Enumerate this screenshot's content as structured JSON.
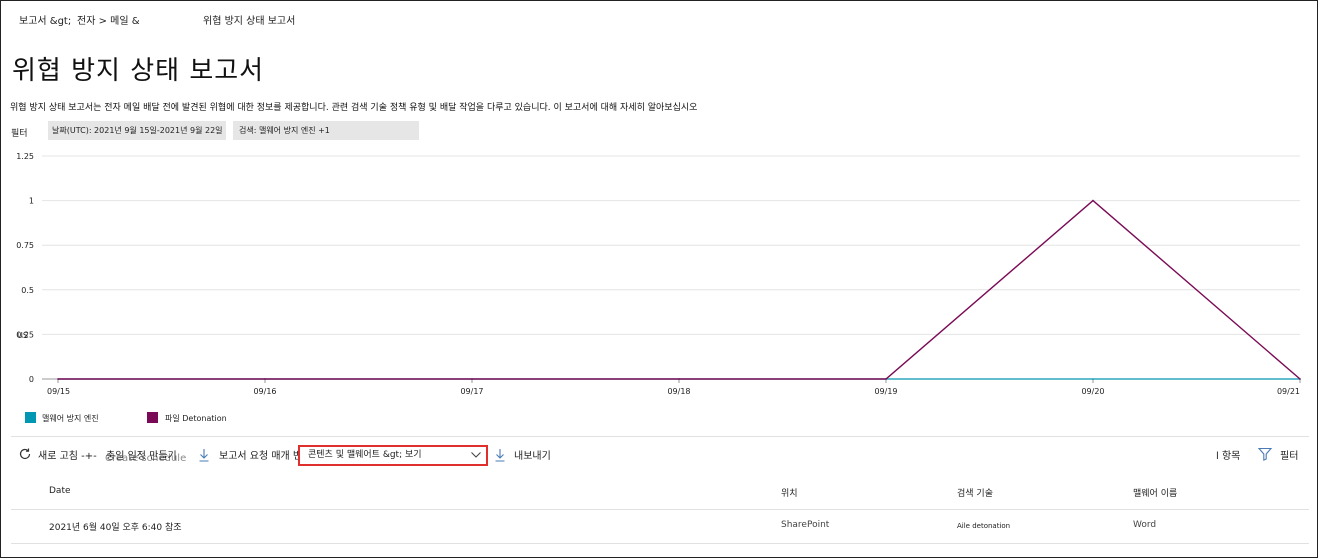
{
  "breadcrumb": {
    "part1": "보고서 &gt;",
    "part2": "전자 > 메일 &",
    "current": "위협 방지 상태 보고서"
  },
  "page": {
    "title": "위협 방지 상태 보고서",
    "description": "위협 방지 상태 보고서는 전자 메일 배달 전에 발견된 위협에 대한 정보를 제공합니다. 관련 검색 기술 정책 유형 및 배달 작업을 다루고 있습니다. 이 보고서에 대해 자세히 알아보십시오"
  },
  "filters": {
    "label": "필터",
    "date_pill": "날짜(UTC): 2021년 9월 15일-2021년 9월 22일",
    "detection_pill": "검색: 맬웨어 방지 엔진 +1"
  },
  "chart_data": {
    "type": "line",
    "x": [
      "09/15",
      "09/16",
      "09/17",
      "09/18",
      "09/19",
      "09/20",
      "09/21"
    ],
    "ylabel": "US",
    "ylim": [
      0,
      1.25
    ],
    "y_ticks": [
      "0",
      "0.25",
      "0.5",
      "0.75",
      "1",
      "1.25"
    ],
    "grid": true,
    "legend_position": "bottom-left",
    "series": [
      {
        "name": "맬웨어 방지 엔진",
        "color": "#0097b2",
        "values": [
          0,
          0,
          0,
          0,
          0,
          0,
          0
        ]
      },
      {
        "name": "파일 Detonation",
        "color": "#7a0a55",
        "values": [
          0,
          0,
          0,
          0,
          0,
          1,
          0
        ]
      }
    ]
  },
  "toolbar": {
    "refresh_label": "새로 고침 -+-",
    "create_schedule_label": "충일 일정 만들기",
    "schedule_overlay_text": "Create schedule",
    "request_report_label": "보고서 요청 매개 변수",
    "view_dropdown_value": "콘텐츠 및 맬웨어트 &gt; 보기",
    "export_label": "내보내기",
    "items_count": "l 항목",
    "filter_label": "필터"
  },
  "table": {
    "headers": [
      "Date",
      "위치",
      "검색 기술",
      "맬웨어 이름"
    ],
    "rows": [
      [
        "2021년 6월 40일 오후 6:40 참조",
        "SharePoint",
        "Aile detonation",
        "Word"
      ]
    ]
  },
  "colors": {
    "highlight_border": "#e0302d",
    "series_teal": "#0097b2",
    "series_plum": "#7a0a55"
  }
}
